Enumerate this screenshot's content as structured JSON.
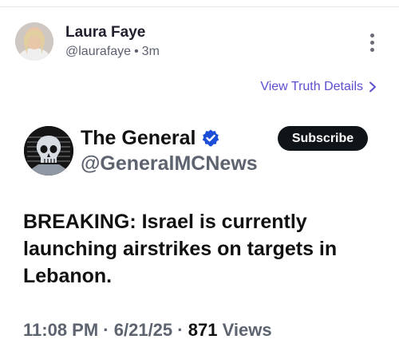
{
  "post": {
    "author_name": "Laura Faye",
    "author_handle": "@laurafaye",
    "separator": "•",
    "time_ago": "3m",
    "more_icon": "vertical-ellipsis-icon",
    "truth_link_label": "View Truth Details"
  },
  "quoted": {
    "name": "The General",
    "handle": "@GeneralMCNews",
    "subscribe_label": "Subscribe",
    "body": "BREAKING: Israel is currently launching airstrikes on targets in Lebanon.",
    "time": "11:08 PM",
    "dot": "·",
    "date": "6/21/25",
    "views_count": "871",
    "views_label": "Views"
  },
  "colors": {
    "link": "#5b4fcf",
    "verified": "#1d4ed8",
    "subscribe_bg": "#0f1419",
    "muted_text": "#5d6470"
  }
}
